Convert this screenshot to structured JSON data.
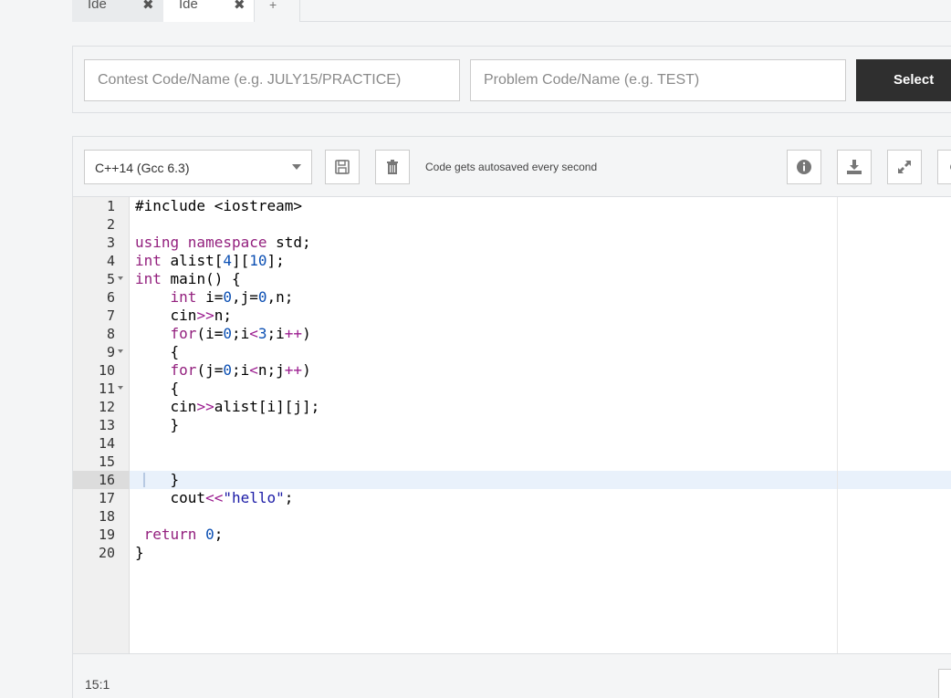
{
  "tabs": [
    {
      "label": "Ide",
      "close": "✖"
    },
    {
      "label": "Ide",
      "close": "✖"
    },
    {
      "label": "+"
    }
  ],
  "problem_selector": {
    "contest_placeholder": "Contest Code/Name (e.g. JULY15/PRACTICE)",
    "problem_placeholder": "Problem Code/Name (e.g. TEST)",
    "select_label": "Select"
  },
  "toolbar": {
    "language": "C++14 (Gcc 6.3)",
    "autosave_text": "Code gets autosaved every second",
    "icons": [
      "save-icon",
      "trash-icon",
      "info-icon",
      "download-icon",
      "fullscreen-icon"
    ]
  },
  "editor": {
    "line_numbers": [
      "1",
      "2",
      "3",
      "4",
      "5",
      "6",
      "7",
      "8",
      "9",
      "10",
      "11",
      "12",
      "13",
      "14",
      "15",
      "16",
      "17",
      "18",
      "19",
      "20"
    ],
    "fold_lines": [
      5,
      9,
      11
    ],
    "active_line": 16
  },
  "status": {
    "cursor_position": "15:1"
  }
}
